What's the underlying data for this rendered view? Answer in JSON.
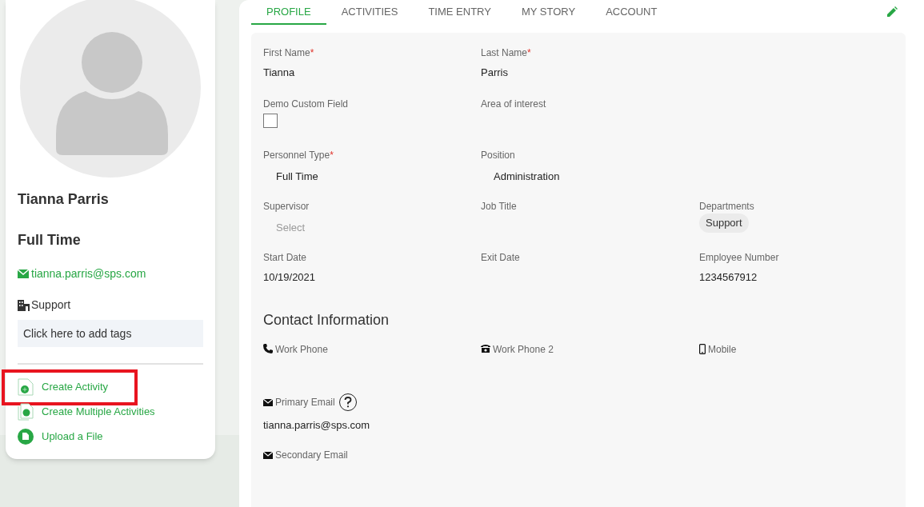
{
  "profile_card": {
    "name": "Tianna Parris",
    "personnel_type": "Full Time",
    "email": "tianna.parris@sps.com",
    "department": "Support",
    "tags_placeholder": "Click here to add tags",
    "actions": [
      {
        "label": "Create Activity",
        "highlighted": true
      },
      {
        "label": "Create Multiple Activities",
        "highlighted": false
      },
      {
        "label": "Upload a File",
        "highlighted": false
      }
    ]
  },
  "tabs": [
    {
      "label": "PROFILE",
      "selected": true
    },
    {
      "label": "ACTIVITIES",
      "selected": false
    },
    {
      "label": "TIME ENTRY",
      "selected": false
    },
    {
      "label": "MY STORY",
      "selected": false
    },
    {
      "label": "ACCOUNT",
      "selected": false
    }
  ],
  "field_rows": [
    [
      {
        "kind": "text",
        "label": "First Name",
        "required_mark": "*",
        "value": "Tianna"
      },
      {
        "kind": "text",
        "label": "Last Name",
        "required_mark": "*",
        "value": "Parris"
      },
      null
    ],
    [
      {
        "kind": "checkbox",
        "label": "Demo Custom Field",
        "checked": false
      },
      {
        "kind": "text",
        "label": "Area of interest"
      },
      null
    ],
    [
      {
        "kind": "select",
        "label": "Personnel Type",
        "required_mark": "*",
        "value": "Full Time"
      },
      {
        "kind": "select",
        "label": "Position",
        "value": "Administration"
      },
      null
    ],
    [
      {
        "kind": "select",
        "label": "Supervisor",
        "placeholder": "Select"
      },
      {
        "kind": "text",
        "label": "Job Title"
      },
      {
        "kind": "chips",
        "label": "Departments",
        "chips": [
          "Support"
        ]
      }
    ],
    [
      {
        "kind": "text",
        "label": "Start Date",
        "value": "10/19/2021"
      },
      {
        "kind": "text",
        "label": "Exit Date"
      },
      {
        "kind": "text",
        "label": "Employee Number",
        "value": "1234567912"
      }
    ]
  ],
  "contact": {
    "heading": "Contact Information",
    "phones": [
      {
        "label": "Work Phone"
      },
      {
        "label": "Work Phone 2"
      },
      {
        "label": "Mobile"
      }
    ],
    "emails": [
      {
        "label": "Primary Email",
        "help": true,
        "value": "tianna.parris@sps.com"
      },
      {
        "label": "Secondary Email",
        "help": false
      }
    ]
  }
}
